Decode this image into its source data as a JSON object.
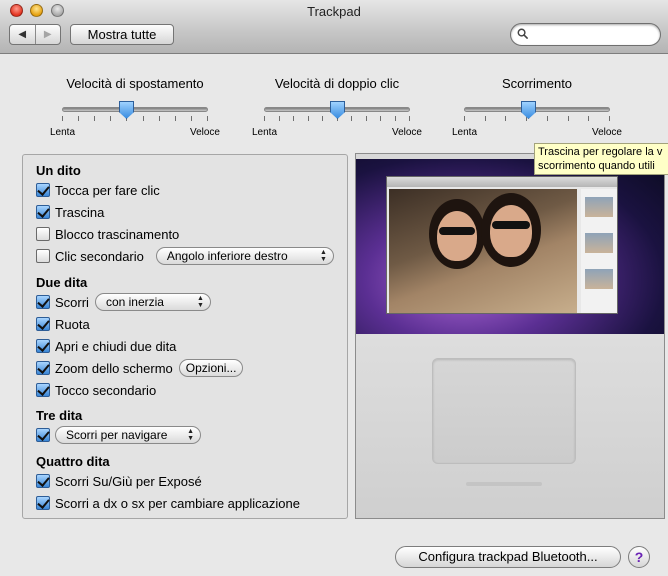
{
  "window": {
    "title": "Trackpad"
  },
  "toolbar": {
    "back_glyph": "◀",
    "forward_glyph": "▶",
    "show_all_label": "Mostra tutte",
    "search_placeholder": ""
  },
  "sliders": [
    {
      "label": "Velocità di spostamento",
      "min_label": "Lenta",
      "max_label": "Veloce",
      "value": 0.44,
      "ticks": 10
    },
    {
      "label": "Velocità di doppio clic",
      "min_label": "Lenta",
      "max_label": "Veloce",
      "value": 0.5,
      "ticks": 11
    },
    {
      "label": "Scorrimento",
      "min_label": "Lenta",
      "max_label": "Veloce",
      "value": 0.44,
      "ticks": 8
    }
  ],
  "tooltip": {
    "line1": "Trascina per regolare la v",
    "line2": "scorrimento quando utili"
  },
  "sections": {
    "one_finger": {
      "title": "Un dito",
      "tap_to_click": {
        "label": "Tocca per fare clic",
        "checked": true
      },
      "drag": {
        "label": "Trascina",
        "checked": true
      },
      "drag_lock": {
        "label": "Blocco trascinamento",
        "checked": false
      },
      "secondary_click": {
        "label": "Clic secondario",
        "checked": false,
        "option": "Angolo inferiore destro"
      }
    },
    "two_fingers": {
      "title": "Due dita",
      "scroll": {
        "label": "Scorri",
        "checked": true,
        "option": "con inerzia"
      },
      "rotate": {
        "label": "Ruota",
        "checked": true
      },
      "pinch": {
        "label": "Apri e chiudi due dita",
        "checked": true
      },
      "zoom": {
        "label": "Zoom dello schermo",
        "checked": true,
        "button": "Opzioni..."
      },
      "secondary_tap": {
        "label": "Tocco secondario",
        "checked": true
      }
    },
    "three_fingers": {
      "title": "Tre dita",
      "swipe": {
        "checked": true,
        "option": "Scorri per navigare"
      }
    },
    "four_fingers": {
      "title": "Quattro dita",
      "expose": {
        "label": "Scorri Su/Giù per Exposé",
        "checked": true
      },
      "switch_app": {
        "label": "Scorri a dx o sx per cambiare applicazione",
        "checked": true
      }
    }
  },
  "bottom": {
    "bluetooth_button": "Configura trackpad Bluetooth...",
    "help_glyph": "?"
  },
  "colors": {
    "accent": "#3a86d6",
    "tooltip_bg": "#ffffc7",
    "help": "#6a22b5"
  }
}
